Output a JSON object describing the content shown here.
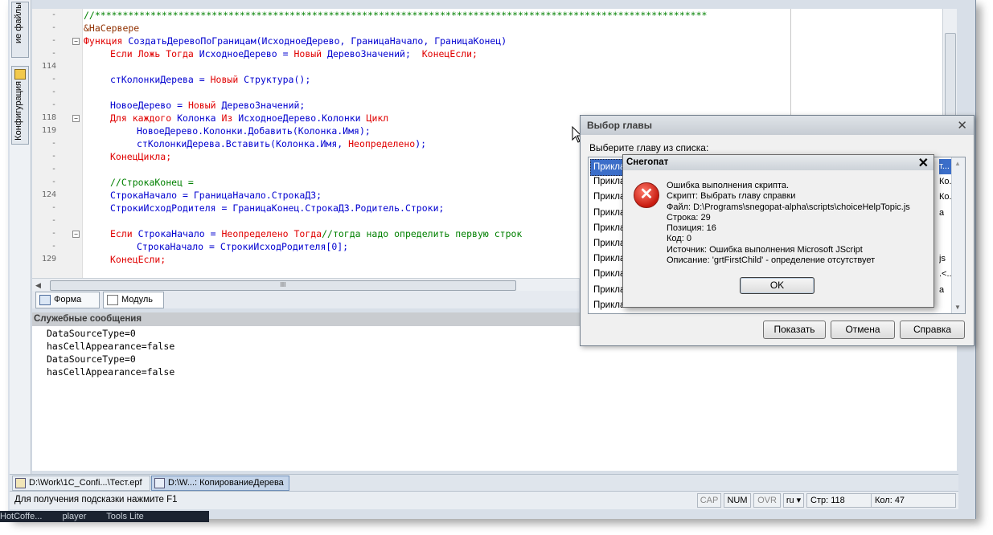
{
  "sidebar": {
    "tab_files": "ие файлы",
    "tab_config": "Конфигурация"
  },
  "editor": {
    "lines": [
      {
        "num": "-",
        "fold": "",
        "indent": 0,
        "tokens": [
          {
            "t": "//**************************************************************************************************************",
            "c": "cm"
          }
        ]
      },
      {
        "num": "-",
        "fold": "",
        "indent": 0,
        "tokens": [
          {
            "t": "&НаСервере",
            "c": "dir"
          }
        ]
      },
      {
        "num": "-",
        "fold": "⊟",
        "indent": 0,
        "tokens": [
          {
            "t": "Функция ",
            "c": "kw"
          },
          {
            "t": "СоздатьДеревоПоГраницам(ИсходноеДерево, ГраницаНачало, ГраницаКонец)",
            "c": "id"
          }
        ]
      },
      {
        "num": "-",
        "fold": "",
        "indent": 1,
        "tokens": [
          {
            "t": "Если Ложь Тогда ",
            "c": "kw"
          },
          {
            "t": "ИсходноеДерево = ",
            "c": "id"
          },
          {
            "t": "Новый ",
            "c": "kw"
          },
          {
            "t": "ДеревоЗначений;  ",
            "c": "id"
          },
          {
            "t": "КонецЕсли;",
            "c": "kw"
          }
        ]
      },
      {
        "num": "114",
        "fold": "",
        "indent": 0,
        "tokens": []
      },
      {
        "num": "-",
        "fold": "",
        "indent": 1,
        "tokens": [
          {
            "t": "стКолонкиДерева = ",
            "c": "id"
          },
          {
            "t": "Новый ",
            "c": "kw"
          },
          {
            "t": "Структура();",
            "c": "id"
          }
        ]
      },
      {
        "num": "-",
        "fold": "",
        "indent": 0,
        "tokens": []
      },
      {
        "num": "-",
        "fold": "",
        "indent": 1,
        "tokens": [
          {
            "t": "НовоеДерево = ",
            "c": "id"
          },
          {
            "t": "Новый ",
            "c": "kw"
          },
          {
            "t": "ДеревоЗначений;",
            "c": "id"
          }
        ]
      },
      {
        "num": "118",
        "fold": "⊟",
        "indent": 1,
        "tokens": [
          {
            "t": "Для каждого ",
            "c": "kw"
          },
          {
            "t": "Колонка ",
            "c": "id"
          },
          {
            "t": "Из ",
            "c": "kw"
          },
          {
            "t": "ИсходноеДерево.Колонки ",
            "c": "id"
          },
          {
            "t": "Цикл",
            "c": "kw"
          }
        ]
      },
      {
        "num": "119",
        "fold": "",
        "indent": 2,
        "tokens": [
          {
            "t": "НовоеДерево.Колонки.Добавить(Колонка.Имя);",
            "c": "id"
          }
        ]
      },
      {
        "num": "-",
        "fold": "",
        "indent": 2,
        "tokens": [
          {
            "t": "стКолонкиДерева.Вставить(Колонка.Имя, ",
            "c": "id"
          },
          {
            "t": "Неопределено",
            "c": "kw"
          },
          {
            "t": ");",
            "c": "id"
          }
        ]
      },
      {
        "num": "-",
        "fold": "",
        "indent": 1,
        "tokens": [
          {
            "t": "КонецЦикла;",
            "c": "kw"
          }
        ]
      },
      {
        "num": "-",
        "fold": "",
        "indent": 0,
        "tokens": []
      },
      {
        "num": "-",
        "fold": "",
        "indent": 1,
        "tokens": [
          {
            "t": "//СтрокаКонец =",
            "c": "cm"
          }
        ]
      },
      {
        "num": "124",
        "fold": "",
        "indent": 1,
        "tokens": [
          {
            "t": "СтрокаНачало = ГраницаНачало.СтрокаДЗ;",
            "c": "id"
          }
        ]
      },
      {
        "num": "-",
        "fold": "",
        "indent": 1,
        "tokens": [
          {
            "t": "СтрокиИсходРодителя = ГраницаКонец.СтрокаДЗ.Родитель.Строки;",
            "c": "id"
          }
        ]
      },
      {
        "num": "-",
        "fold": "",
        "indent": 0,
        "tokens": []
      },
      {
        "num": "-",
        "fold": "⊟",
        "indent": 1,
        "tokens": [
          {
            "t": "Если ",
            "c": "kw"
          },
          {
            "t": "СтрокаНачало = ",
            "c": "id"
          },
          {
            "t": "Неопределено Тогда",
            "c": "kw"
          },
          {
            "t": "//тогда надо определить первую строк",
            "c": "cm"
          }
        ]
      },
      {
        "num": "-",
        "fold": "",
        "indent": 2,
        "tokens": [
          {
            "t": "СтрокаНачало = СтрокиИсходРодителя[0];",
            "c": "id"
          }
        ]
      },
      {
        "num": "129",
        "fold": "",
        "indent": 1,
        "tokens": [
          {
            "t": "КонецЕсли;",
            "c": "kw"
          }
        ]
      }
    ],
    "hscroll_mark": "III"
  },
  "tabs": [
    {
      "label": "Форма"
    },
    {
      "label": "Модуль"
    }
  ],
  "messages": {
    "header": "Служебные сообщения",
    "lines": [
      "DataSourceType=0",
      "hasCellAppearance=false",
      "DataSourceType=0",
      "hasCellAppearance=false"
    ]
  },
  "window_tabs": [
    {
      "label": "D:\\Work\\1C_Confi...\\Тест.epf"
    },
    {
      "label": "D:\\W...: КопированиеДерева"
    }
  ],
  "status": {
    "hint": "Для получения подсказки нажмите F1",
    "cap": "CAP",
    "num": "NUM",
    "ovr": "OVR",
    "lang": "ru ▾",
    "row": "Стр: 118",
    "col": "Кол: 47"
  },
  "taskbar": {
    "items": [
      "HotCoffe...",
      "player",
      "Tools Lite"
    ]
  },
  "chooser": {
    "title": "Выбор главы",
    "prompt": "Выберите главу из списка:",
    "items": [
      "Прикла",
      "Прикла",
      "Прикла",
      "Прикла",
      "Прикла",
      "Прикла",
      "Прикла",
      "Прикла",
      "Прикла",
      "Прикла"
    ],
    "right_items": [
      "т...",
      "Ко...",
      "Ко...",
      "а",
      "",
      "",
      "js",
      ".<...",
      "а",
      ""
    ],
    "buttons": {
      "show": "Показать",
      "cancel": "Отмена",
      "help": "Справка"
    }
  },
  "error_dialog": {
    "title": "Снегопат",
    "lines": [
      "Ошибка выполнения скрипта.",
      "Скрипт:   Выбрать главу справки",
      "Файл:     D:\\Programs\\snegopat-alpha\\scripts\\choiceHelpTopic.js",
      "Строка:   29",
      "Позиция:  16",
      "Код:      0",
      "Источник: Ошибка выполнения Microsoft JScript",
      "Описание: 'grtFirstChild' - определение отсутствует"
    ],
    "ok": "OK"
  },
  "colors": {
    "keyword": "#e00000",
    "identifier": "#0000d0",
    "comment": "#008000",
    "selection": "#3b6ec9"
  }
}
